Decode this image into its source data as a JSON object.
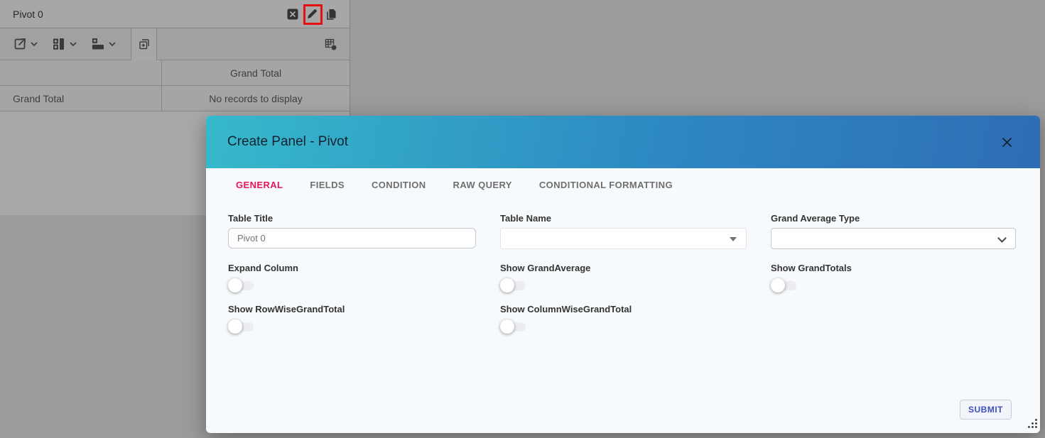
{
  "panel": {
    "title": "Pivot 0",
    "table": {
      "column_header": "Grand Total",
      "row_header": "Grand Total",
      "empty_message": "No records to display"
    }
  },
  "modal": {
    "title": "Create Panel - Pivot",
    "tabs": [
      {
        "label": "GENERAL",
        "active": true
      },
      {
        "label": "FIELDS",
        "active": false
      },
      {
        "label": "CONDITION",
        "active": false
      },
      {
        "label": "RAW QUERY",
        "active": false
      },
      {
        "label": "CONDITIONAL FORMATTING",
        "active": false
      }
    ],
    "fields": {
      "table_title": {
        "label": "Table Title",
        "value": "Pivot 0"
      },
      "table_name": {
        "label": "Table Name",
        "value": ""
      },
      "grand_average_type": {
        "label": "Grand Average Type",
        "value": ""
      }
    },
    "toggles": [
      {
        "label": "Expand Column",
        "on": false
      },
      {
        "label": "Show GrandAverage",
        "on": false
      },
      {
        "label": "Show GrandTotals",
        "on": false
      },
      {
        "label": "Show RowWiseGrandTotal",
        "on": false
      },
      {
        "label": "Show ColumnWiseGrandTotal",
        "on": false
      }
    ],
    "footer": {
      "submit_label": "SUBMIT"
    }
  },
  "colors": {
    "accent_pink": "#e3165b",
    "header_gradient_start": "#36b9cb",
    "header_gradient_end": "#2e6db6",
    "submit_text": "#3b4fc0",
    "annotation_red": "#e60f12"
  }
}
